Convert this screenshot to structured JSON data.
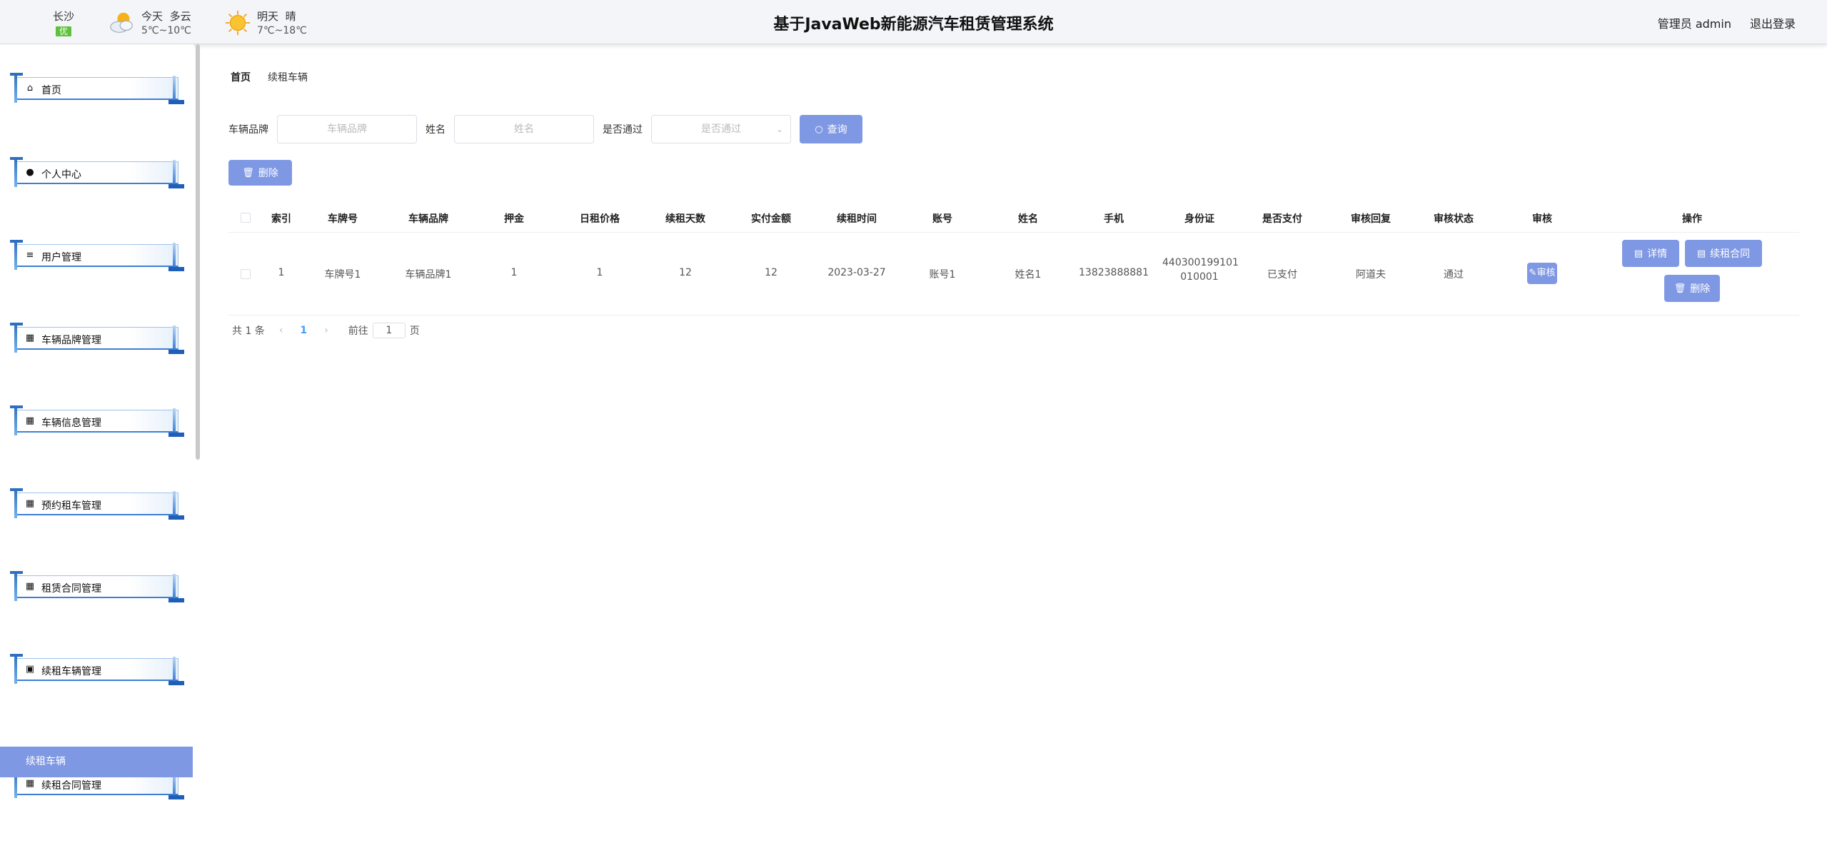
{
  "header": {
    "city": "长沙",
    "aqi": "优",
    "today": {
      "label": "今天",
      "desc": "多云",
      "temp": "5℃~10℃",
      "icon": "partly-cloudy-icon"
    },
    "tomorrow": {
      "label": "明天",
      "desc": "晴",
      "temp": "7℃~18℃",
      "icon": "sunny-icon"
    },
    "title": "基于JavaWeb新能源汽车租赁管理系统",
    "user_role": "管理员",
    "user_name": "admin",
    "logout": "退出登录"
  },
  "sidebar": {
    "items": [
      {
        "label": "首页",
        "icon": "home-icon"
      },
      {
        "label": "个人中心",
        "icon": "user-icon"
      },
      {
        "label": "用户管理",
        "icon": "list-icon"
      },
      {
        "label": "车辆品牌管理",
        "icon": "grid-icon"
      },
      {
        "label": "车辆信息管理",
        "icon": "grid-icon"
      },
      {
        "label": "预约租车管理",
        "icon": "grid3-icon"
      },
      {
        "label": "租赁合同管理",
        "icon": "grid-icon"
      },
      {
        "label": "续租车辆管理",
        "icon": "clipboard-icon"
      },
      {
        "label": "续租合同管理",
        "icon": "grid-icon"
      }
    ],
    "active_sub": "续租车辆"
  },
  "breadcrumb": {
    "home": "首页",
    "current": "续租车辆"
  },
  "search": {
    "brand_label": "车辆品牌",
    "brand_placeholder": "车辆品牌",
    "name_label": "姓名",
    "name_placeholder": "姓名",
    "pass_label": "是否通过",
    "pass_placeholder": "是否通过",
    "query_button": "查询"
  },
  "toolbar": {
    "delete_button": "删除"
  },
  "table": {
    "headers": [
      "索引",
      "车牌号",
      "车辆品牌",
      "押金",
      "日租价格",
      "续租天数",
      "实付金额",
      "续租时间",
      "账号",
      "姓名",
      "手机",
      "身份证",
      "是否支付",
      "审核回复",
      "审核状态",
      "审核",
      "操作"
    ],
    "rows": [
      {
        "index": "1",
        "plate": "车牌号1",
        "brand": "车辆品牌1",
        "deposit": "1",
        "daily_price": "1",
        "days": "12",
        "paid": "12",
        "time": "2023-03-27",
        "account": "账号1",
        "name": "姓名1",
        "phone": "13823888881",
        "id_card_l1": "440300199101",
        "id_card_l2": "010001",
        "is_paid": "已支付",
        "reply": "阿道夫",
        "status": "通过",
        "audit_button": "审核",
        "detail_button": "详情",
        "contract_button": "续租合同",
        "delete_button": "删除"
      }
    ]
  },
  "pager": {
    "total": "共 1 条",
    "current": "1",
    "goto": "前往",
    "page_value": "1",
    "page_unit": "页"
  },
  "colors": {
    "primary": "#7f98e4",
    "aqi": "#5fc13b",
    "menu_border": "#3c7fd4"
  }
}
